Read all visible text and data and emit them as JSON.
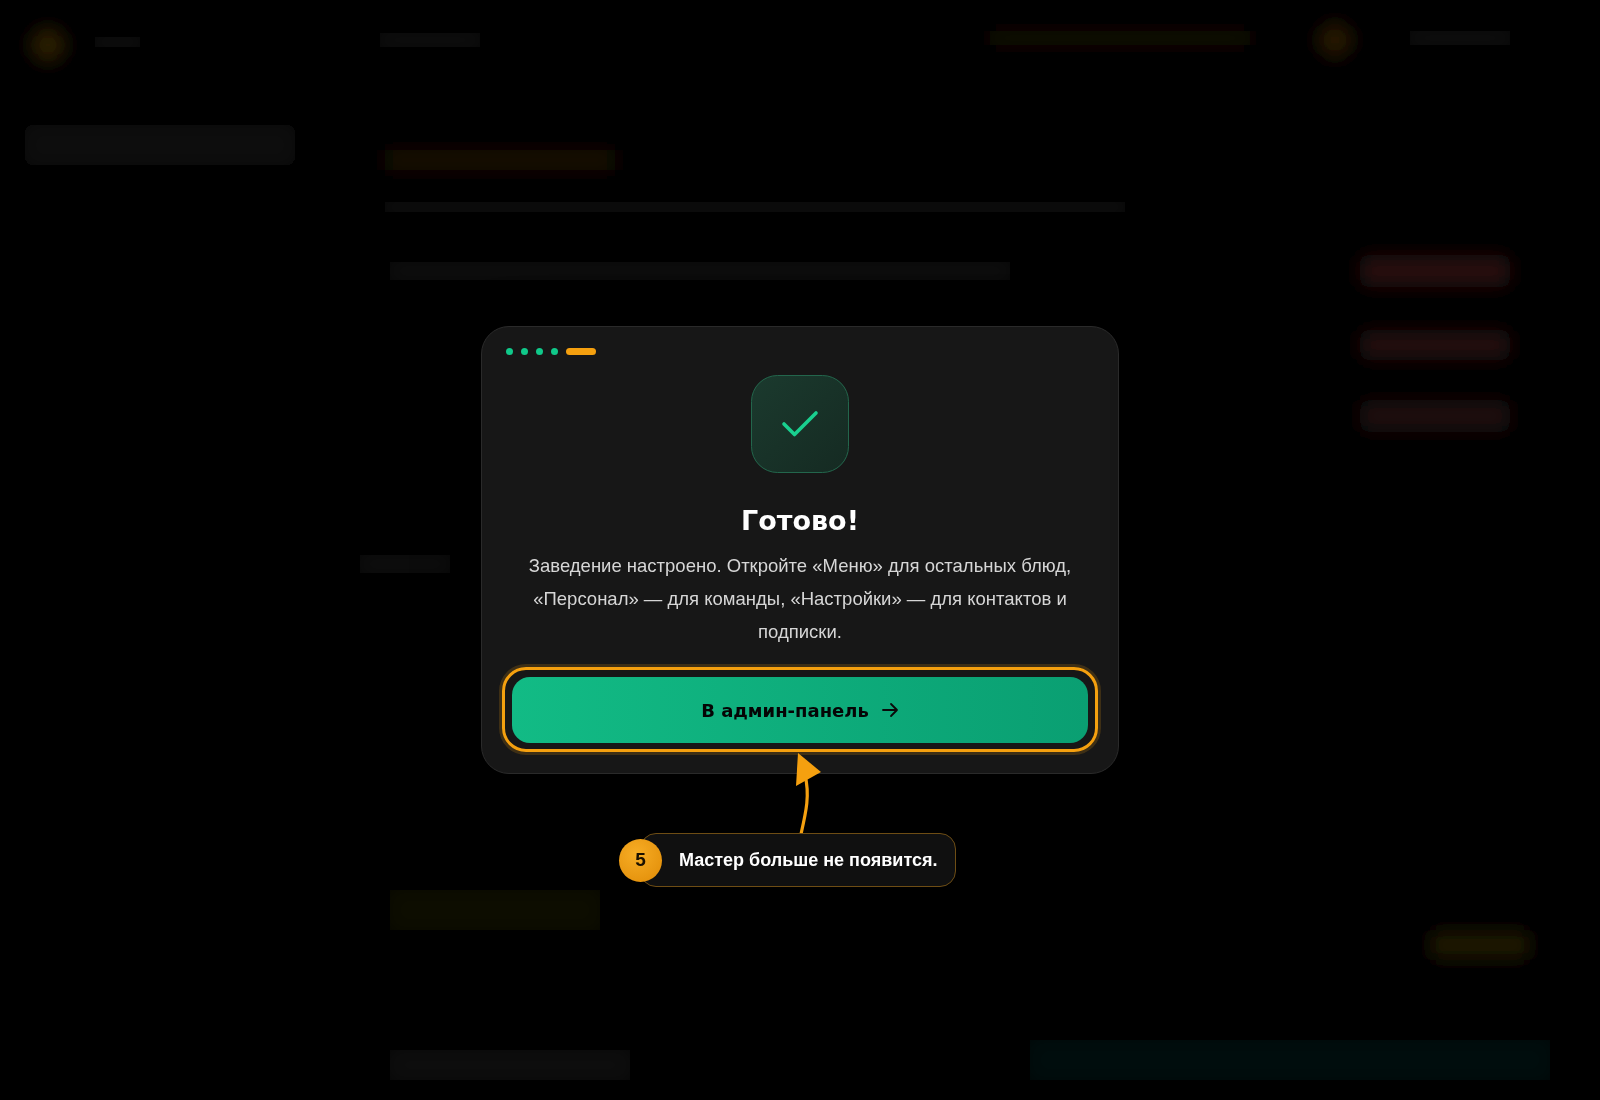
{
  "dialog": {
    "steps": [
      {
        "selected": false
      },
      {
        "selected": false
      },
      {
        "selected": false
      },
      {
        "selected": false
      },
      {
        "selected": true
      }
    ],
    "title": "Готово!",
    "message": "Заведение настроено. Откройте «Меню» для остальных блюд, «Персонал» — для команды, «Настройки» — для контактов и подписки.",
    "button": {
      "label": "В админ-панель",
      "highlighted": true
    }
  },
  "tour_tip": {
    "step": "5",
    "text": "Мастер больше не появится."
  }
}
